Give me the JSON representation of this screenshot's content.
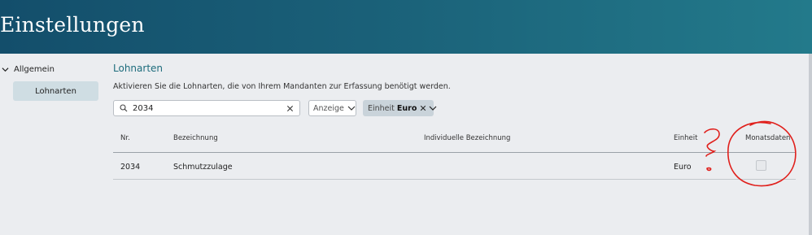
{
  "header": {
    "title": "Einstellungen"
  },
  "sidebar": {
    "group_label": "Allgemein",
    "items": [
      {
        "label": "Lohnarten"
      }
    ]
  },
  "main": {
    "title": "Lohnarten",
    "description": "Aktivieren Sie die Lohnarten, die von Ihrem Mandanten zur Erfassung benötigt werden.",
    "search": {
      "value": "2034",
      "placeholder": ""
    },
    "display_select": {
      "label": "Anzeige"
    },
    "filter_chip": {
      "label": "Einheit",
      "value": "Euro"
    }
  },
  "table": {
    "headers": {
      "nr": "Nr.",
      "bezeichnung": "Bezeichnung",
      "individuell": "Individuelle Bezeichnung",
      "einheit": "Einheit",
      "monatsdaten": "Monatsdaten"
    },
    "rows": [
      {
        "nr": "2034",
        "bezeichnung": "Schmutzzulage",
        "individuell": "",
        "einheit": "Euro",
        "monatsdaten": false
      }
    ]
  },
  "annotation": {
    "color": "#e0201c"
  },
  "icons": [
    "chevron-down-icon",
    "search-icon",
    "close-icon"
  ]
}
